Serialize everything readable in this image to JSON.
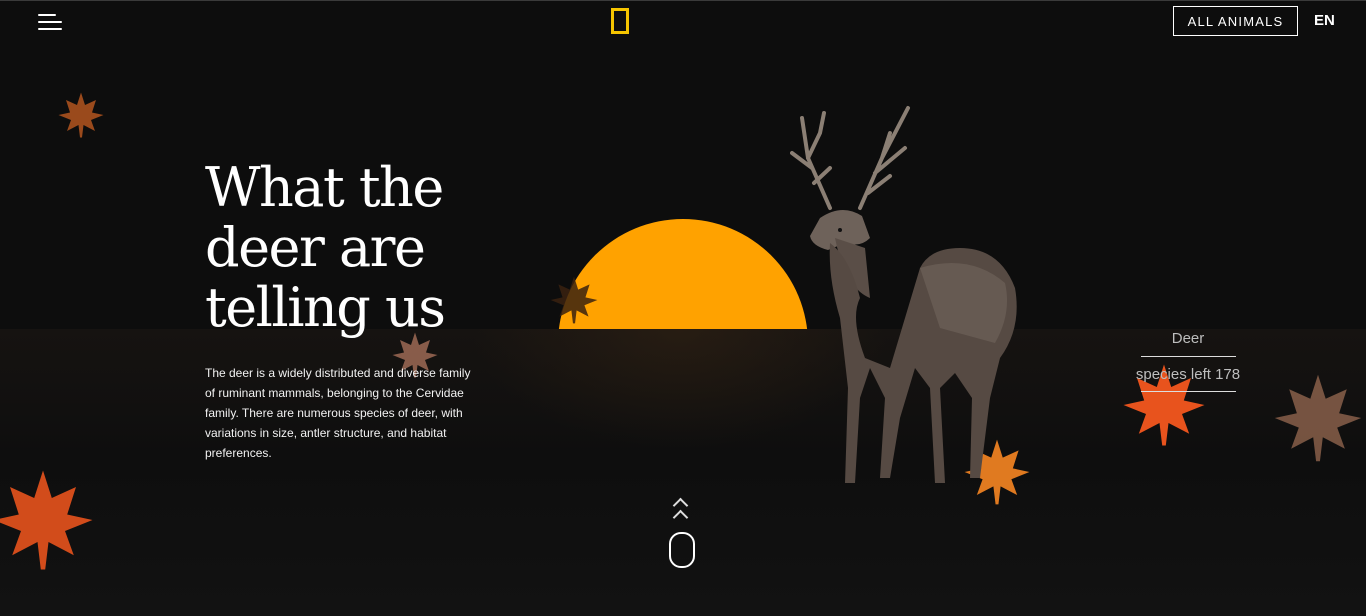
{
  "header": {
    "menu_icon": "hamburger-menu-icon",
    "logo_icon": "yellow-rectangle-logo-icon",
    "all_animals_label": "ALL ANIMALS",
    "language_label": "EN"
  },
  "hero": {
    "title_line1": "What the",
    "title_line2": "deer are",
    "title_line3": "telling us",
    "description": "The deer is a widely distributed and diverse family of ruminant mammals, belonging to the Cervidae family. There are numerous species of deer, with variations in size, antler structure, and habitat preferences."
  },
  "species_panel": {
    "name": "Deer",
    "count_text": "species left 178"
  },
  "scroll": {
    "icon": "scroll-mouse-icon",
    "arrows_icon": "double-chevron-up-icon"
  },
  "colors": {
    "background": "#0d0d0d",
    "sun": "#ffa200",
    "logo": "#f5c400",
    "leaf_orange": "#e8531d",
    "leaf_brown": "#9a4a1c"
  },
  "decor": {
    "deer_illustration": "deer-illustration",
    "leaves": "maple-leaf-icon"
  }
}
